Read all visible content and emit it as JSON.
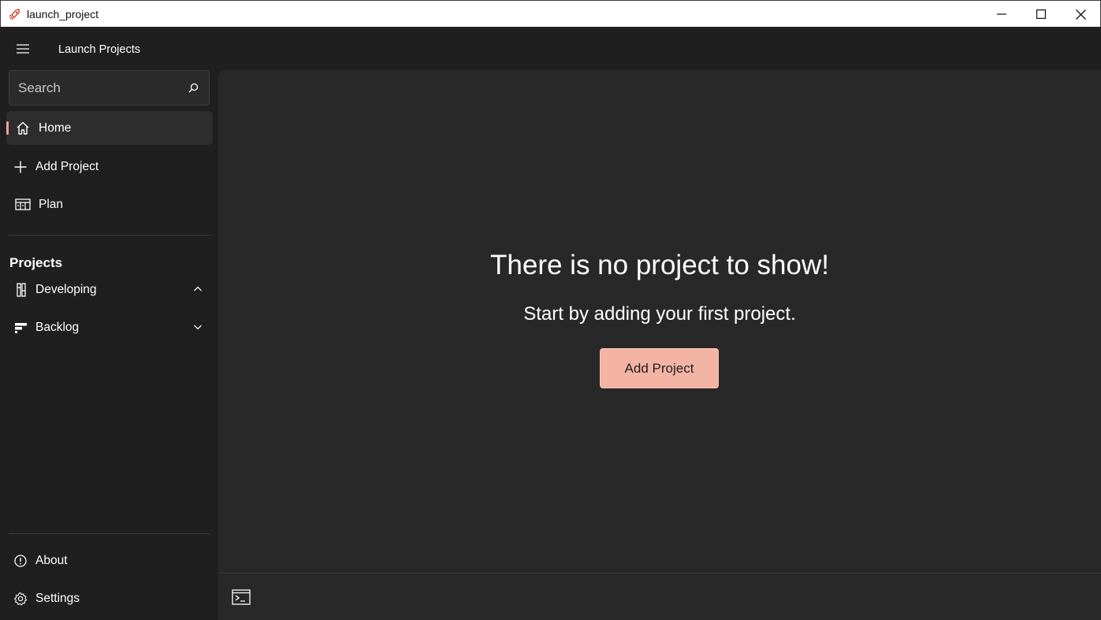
{
  "window": {
    "title": "launch_project",
    "icon": "rocket-icon",
    "controls": [
      "minimize-icon",
      "maximize-icon",
      "close-icon"
    ]
  },
  "header": {
    "menu_icon": "hamburger-icon",
    "app_title": "Launch Projects"
  },
  "search": {
    "placeholder": "Search",
    "icon": "search-icon"
  },
  "nav": {
    "items": [
      {
        "label": "Home",
        "icon": "home-icon",
        "selected": true
      },
      {
        "label": "Add Project",
        "icon": "plus-icon"
      },
      {
        "label": "Plan",
        "icon": "plan-board-icon"
      }
    ],
    "section_title": "Projects",
    "groups": [
      {
        "label": "Developing",
        "icon": "developing-icon",
        "expanded": true
      },
      {
        "label": "Backlog",
        "icon": "backlog-icon",
        "expanded": false
      }
    ],
    "footer_items": [
      {
        "label": "About",
        "icon": "info-icon"
      },
      {
        "label": "Settings",
        "icon": "gear-icon"
      }
    ]
  },
  "main": {
    "empty_title": "There is no project to show!",
    "empty_subtitle": "Start by adding your first project.",
    "cta_label": "Add Project"
  },
  "footer": {
    "icon": "terminal-icon"
  },
  "colors": {
    "accent": "#f4b4a4",
    "selection_indicator": "#f4a592",
    "sidebar_bg": "#1f1f1f",
    "content_bg": "#282828"
  }
}
